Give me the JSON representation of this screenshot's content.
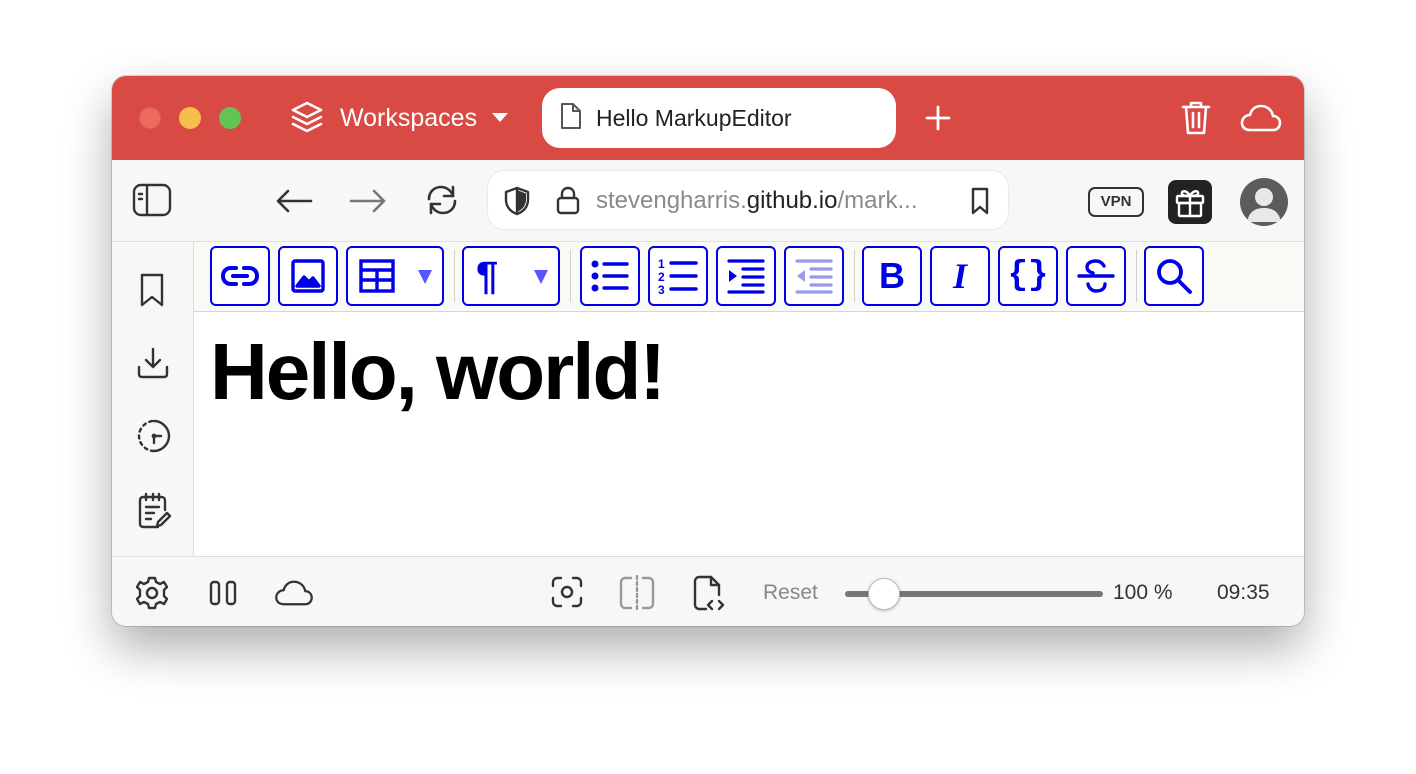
{
  "window": {
    "accent_color": "#d94a45",
    "traffic_lights": [
      "close",
      "minimize",
      "zoom"
    ]
  },
  "titlebar": {
    "workspaces_label": "Workspaces",
    "active_tab": {
      "title": "Hello MarkupEditor",
      "icon": "page-icon"
    },
    "icons": [
      "layers-icon",
      "chevron-down-icon",
      "plus-icon",
      "trash-icon",
      "cloud-icon"
    ]
  },
  "navbar": {
    "url": {
      "prefix": "stevengharris.",
      "domain": "github.io",
      "suffix": "/mark..."
    },
    "vpn_label": "VPN",
    "icons": [
      "sidebar-toggle-icon",
      "back-arrow-icon",
      "forward-arrow-icon",
      "reload-icon",
      "shield-icon",
      "lock-icon",
      "bookmark-icon",
      "gift-icon",
      "avatar"
    ]
  },
  "sidebar": {
    "items": [
      "bookmark-icon",
      "download-icon",
      "history-icon",
      "notes-icon"
    ]
  },
  "toolbar": {
    "accent_color": "#0000e6",
    "buttons": [
      "link",
      "image",
      "table",
      "paragraph-style",
      "bullet-list",
      "numbered-list",
      "indent",
      "outdent",
      "bold",
      "italic",
      "code",
      "strikethrough",
      "search"
    ],
    "style_glyph": "¶",
    "bold_glyph": "B",
    "italic_glyph": "I",
    "code_glyph": "{}"
  },
  "document": {
    "heading": "Hello, world!"
  },
  "statusbar": {
    "reset_label": "Reset",
    "zoom_fraction": 0.15,
    "zoom_label": "100 %",
    "time": "09:35",
    "icons": [
      "settings-icon",
      "pause-icon",
      "cloud-icon",
      "screenshot-icon",
      "split-view-icon",
      "page-source-icon"
    ]
  }
}
